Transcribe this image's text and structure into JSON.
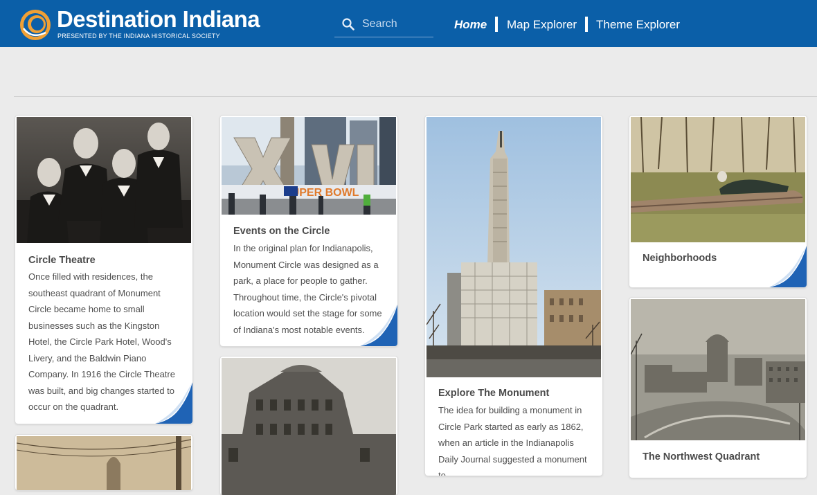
{
  "header": {
    "brand": "Destination Indiana",
    "tagline": "PRESENTED BY THE INDIANA HISTORICAL SOCIETY",
    "search_placeholder": "Search",
    "nav": [
      {
        "label": "Home"
      },
      {
        "label": "Map Explorer"
      },
      {
        "label": "Theme Explorer"
      }
    ],
    "colors": {
      "bar": "#0b5fa8",
      "logo_ring": "#f0a035"
    }
  },
  "cards": [
    {
      "title": "Circle Theatre",
      "text": "Once filled with residences, the southeast quadrant of Monument Circle became home to small businesses such as the Kingston Hotel, the Circle Park Hotel, Wood's Livery, and the Baldwin Piano Company. In 1916 the Circle Theatre was built, and big changes started to occur on the quadrant.",
      "image": "sepia portrait of four men"
    },
    {
      "title": "Events on the Circle",
      "text": "In the original plan for Indianapolis, Monument Circle was designed as a park, a place for people to gather. Throughout time, the Circle's pivotal location would set the stage for some of Indiana's most notable events.",
      "image": "XLVI sculpture on Monument Circle"
    },
    {
      "title": "Explore The Monument",
      "text": "The idea for building a monument in Circle Park started as early as 1862, when an article in the Indianapolis Daily Journal suggested a monument to",
      "image": "Soldiers and Sailors Monument under construction"
    },
    {
      "title": "Neighborhoods",
      "text": "",
      "image": "man lying on a log in a park"
    },
    {
      "title": "The Northwest Quadrant",
      "text": "",
      "image": "old aerial view of the circle"
    },
    {
      "title": "",
      "text": "",
      "image": "old photo of a street"
    },
    {
      "title": "",
      "text": "",
      "image": "old photo of an ornate building"
    }
  ]
}
